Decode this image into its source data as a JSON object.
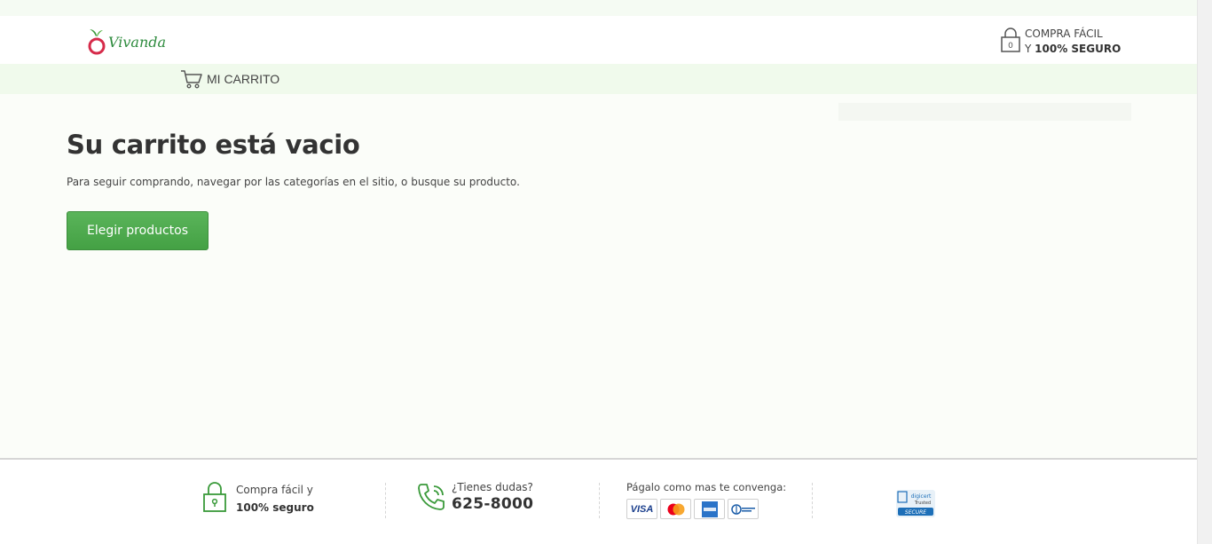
{
  "header": {
    "logo_text": "Vivanda",
    "secure_line1": "COMPRA FÁCIL",
    "secure_line2_prefix": "Y ",
    "secure_line2_bold": "100% SEGURO"
  },
  "cartbar": {
    "label": "MI CARRITO"
  },
  "main": {
    "title": "Su carrito está vacio",
    "subtitle": "Para seguir comprando, navegar por las categorías en el sitio, o busque su producto.",
    "button_label": "Elegir productos"
  },
  "footer": {
    "secure_line1": "Compra fácil y",
    "secure_line2": "100% seguro",
    "doubts_label": "¿Tienes dudas?",
    "phone": "625-8000",
    "payment_label": "Págalo como mas te convenga:",
    "visa_label": "VISA",
    "digicert_line1": "digicert",
    "digicert_line2": "Trusted",
    "digicert_line3": "SECURE"
  },
  "icons": {
    "logo": "vivanda-logo-icon",
    "lock": "lock-icon",
    "cart": "shopping-cart-icon",
    "phone": "phone-icon"
  },
  "colors": {
    "brand_green": "#44a144",
    "accent_red": "#d62b4a",
    "cartbar_bg": "#f0faec"
  }
}
